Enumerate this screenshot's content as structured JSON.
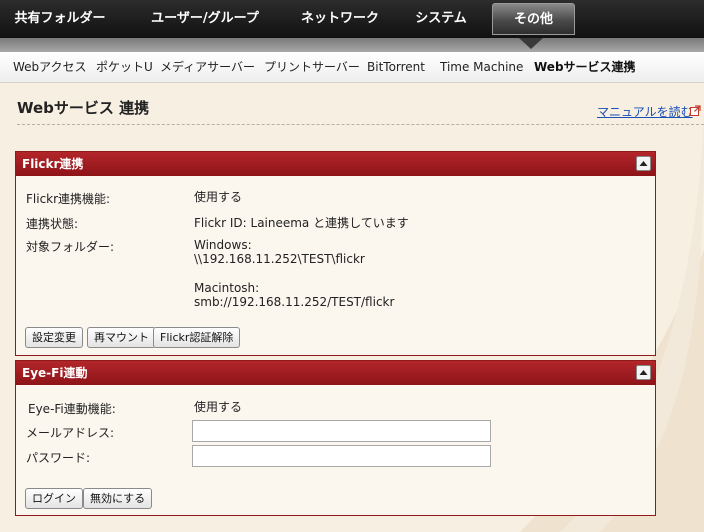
{
  "topnav": {
    "tabs": [
      {
        "label": "共有フォルダー"
      },
      {
        "label": "ユーザー/グループ"
      },
      {
        "label": "ネットワーク"
      },
      {
        "label": "システム"
      },
      {
        "label": "その他"
      }
    ],
    "active_tab": "その他"
  },
  "subnav": {
    "items": [
      {
        "label": "Webアクセス"
      },
      {
        "label": "ポケットU"
      },
      {
        "label": "メディアサーバー"
      },
      {
        "label": "プリントサーバー"
      },
      {
        "label": "BitTorrent"
      },
      {
        "label": "Time Machine"
      },
      {
        "label": "Webサービス連携"
      }
    ],
    "active_item": "Webサービス連携"
  },
  "page": {
    "title": "Webサービス 連携",
    "manual_link": "マニュアルを読む"
  },
  "flickr": {
    "header": "Flickr連携",
    "rows": [
      {
        "label": "Flickr連携機能:",
        "value": "使用する"
      },
      {
        "label": "連携状態:",
        "value": "Flickr ID: Laineema と連携しています"
      },
      {
        "label": "対象フォルダー:",
        "value": "Windows:"
      }
    ],
    "windows_path": "\\\\192.168.11.252\\TEST\\flickr",
    "mac_label": "Macintosh:",
    "mac_path": "smb://192.168.11.252/TEST/flickr",
    "buttons": {
      "settings": "設定変更",
      "remount": "再マウント",
      "deauth": "Flickr認証解除"
    }
  },
  "eyefi": {
    "header": "Eye-Fi連動",
    "function_label": "Eye-Fi連動機能:",
    "function_value": "使用する",
    "email_label": "メールアドレス:",
    "email_value": "",
    "password_label": "パスワード:",
    "password_value": "",
    "buttons": {
      "login": "ログイン",
      "disable": "無効にする"
    }
  },
  "colors": {
    "panel_header": "#9e1c20",
    "link": "#1a4fb3",
    "background": "#f7efe2"
  }
}
